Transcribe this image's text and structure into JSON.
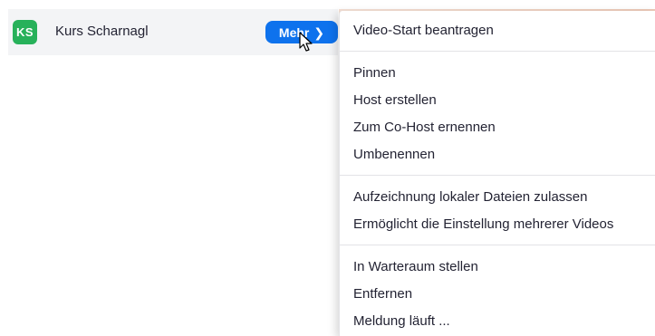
{
  "theme": {
    "accent": "#0e72ed",
    "avatar_bg": "#27b15a"
  },
  "participant": {
    "initials": "KS",
    "name": "Kurs Scharnagl"
  },
  "more_button": {
    "label": "Mehr",
    "icon": "chevron-right-icon"
  },
  "menu": {
    "sections": [
      {
        "items": [
          "Video-Start beantragen"
        ]
      },
      {
        "items": [
          "Pinnen",
          "Host erstellen",
          "Zum Co-Host ernennen",
          "Umbenennen"
        ]
      },
      {
        "items": [
          "Aufzeichnung lokaler Dateien zulassen",
          "Ermöglicht die Einstellung mehrerer Videos"
        ]
      },
      {
        "items": [
          "In Warteraum stellen",
          "Entfernen",
          "Meldung läuft ..."
        ]
      }
    ]
  }
}
